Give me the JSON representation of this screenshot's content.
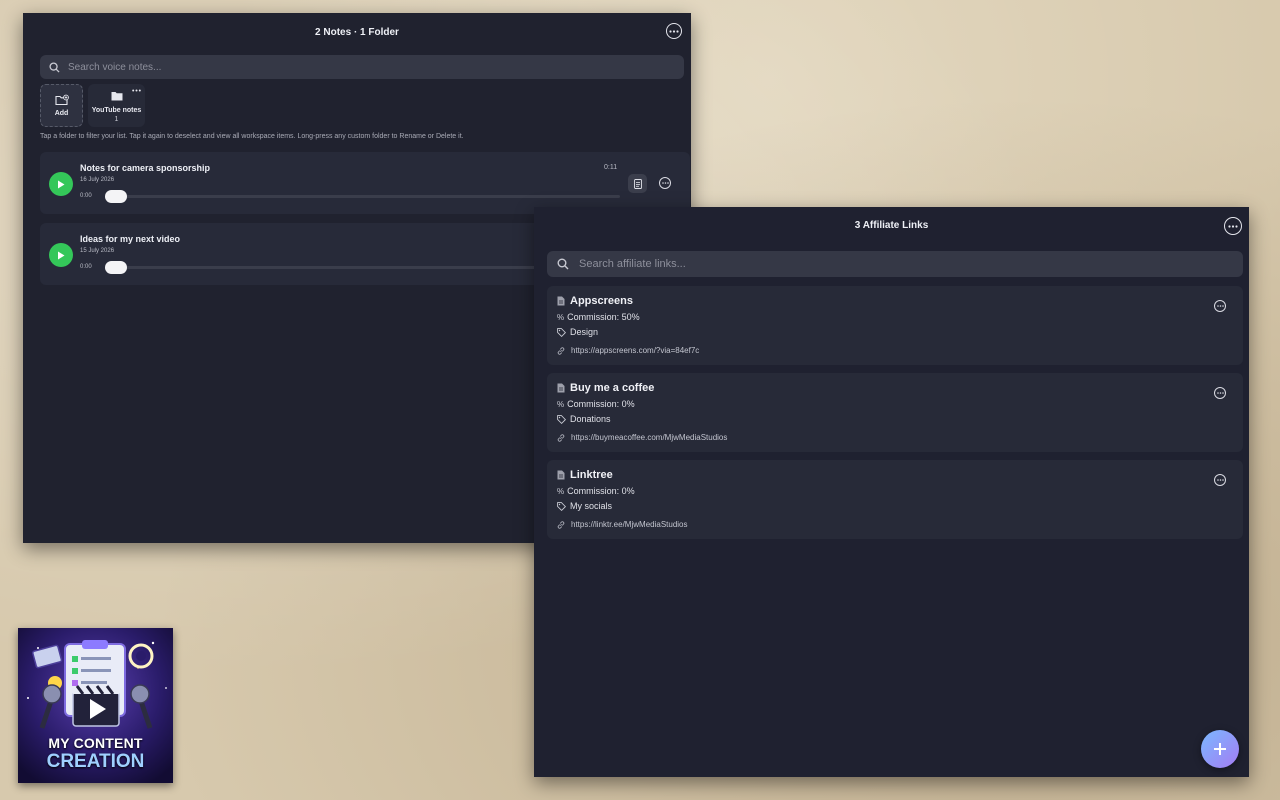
{
  "notes_window": {
    "title": "2 Notes · 1 Folder",
    "search_placeholder": "Search voice notes...",
    "add_folder_label": "Add",
    "folder": {
      "name": "YouTube notes",
      "count": "1"
    },
    "hint": "Tap a folder to filter your list. Tap it again to deselect and view all workspace items. Long-press any custom folder to Rename or Delete it.",
    "notes": [
      {
        "title": "Notes for camera sponsorship",
        "date": "16 July 2026",
        "position": "0:00",
        "duration": "0:11",
        "progress": 0
      },
      {
        "title": "Ideas for my next video",
        "date": "15 July 2026",
        "position": "0:00",
        "duration": "",
        "progress": 0
      }
    ]
  },
  "links_window": {
    "title": "3 Affiliate Links",
    "search_placeholder": "Search affiliate links...",
    "commission_prefix": "%",
    "links": [
      {
        "name": "Appscreens",
        "commission": "Commission: 50%",
        "category": "Design",
        "url": "https://appscreens.com/?via=84ef7c"
      },
      {
        "name": "Buy me a coffee",
        "commission": "Commission: 0%",
        "category": "Donations",
        "url": "https://buymeacoffee.com/MjwMediaStudios"
      },
      {
        "name": "Linktree",
        "commission": "Commission: 0%",
        "category": "My socials",
        "url": "https://linktr.ee/MjwMediaStudios"
      }
    ]
  },
  "logo": {
    "line1": "MY CONTENT",
    "line2": "CREATION"
  },
  "colors": {
    "play": "#34c759",
    "fab_start": "#7ab8ff",
    "fab_end": "#a47cf3",
    "window_bg": "#20222f"
  }
}
